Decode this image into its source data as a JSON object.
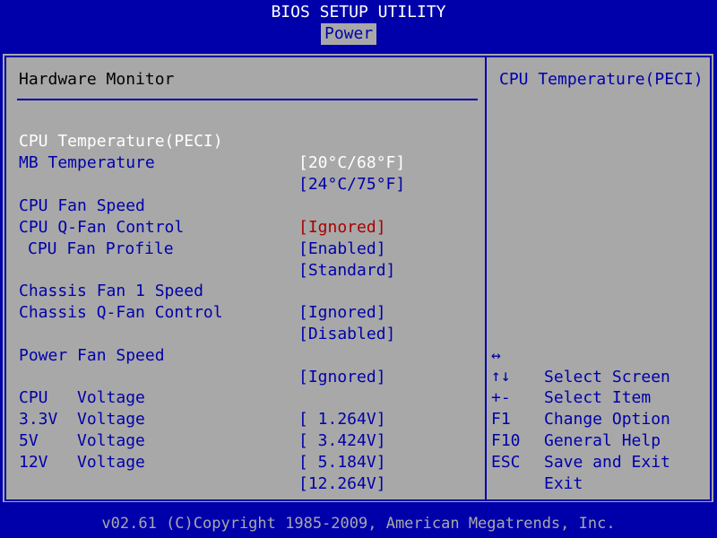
{
  "header": {
    "title": "BIOS SETUP UTILITY",
    "active_tab": "Power"
  },
  "section_title": "Hardware Monitor",
  "items": [
    {
      "label": "CPU Temperature(PECI)",
      "value": "[20°C/68°F]"
    },
    {
      "label": "MB Temperature",
      "value": "[24°C/75°F]"
    },
    {
      "label": "CPU Fan Speed",
      "value": "[Ignored]"
    },
    {
      "label": "CPU Q-Fan Control",
      "value": "[Enabled]"
    },
    {
      "label": "CPU Fan Profile",
      "value": "[Standard]"
    },
    {
      "label": "Chassis Fan 1 Speed",
      "value": "[Ignored]"
    },
    {
      "label": "Chassis Q-Fan Control",
      "value": "[Disabled]"
    },
    {
      "label": "Power Fan Speed",
      "value": "[Ignored]"
    },
    {
      "label": "CPU   Voltage",
      "value": "[ 1.264V]"
    },
    {
      "label": "3.3V  Voltage",
      "value": "[ 3.424V]"
    },
    {
      "label": "5V    Voltage",
      "value": "[ 5.184V]"
    },
    {
      "label": "12V   Voltage",
      "value": "[12.264V]"
    }
  ],
  "help": {
    "title": "CPU Temperature(PECI)"
  },
  "keys": [
    {
      "key": "↔",
      "desc": "Select Screen"
    },
    {
      "key": "↑↓",
      "desc": "Select Item"
    },
    {
      "key": "+-",
      "desc": "Change Option"
    },
    {
      "key": "F1",
      "desc": "General Help"
    },
    {
      "key": "F10",
      "desc": "Save and Exit"
    },
    {
      "key": "ESC",
      "desc": "Exit"
    }
  ],
  "footer": "v02.61 (C)Copyright 1985-2009, American Megatrends, Inc.",
  "colors": {
    "background": "#0000aa",
    "panel": "#a8a8a8",
    "highlight": "#ffffff",
    "warning": "#aa0000"
  }
}
